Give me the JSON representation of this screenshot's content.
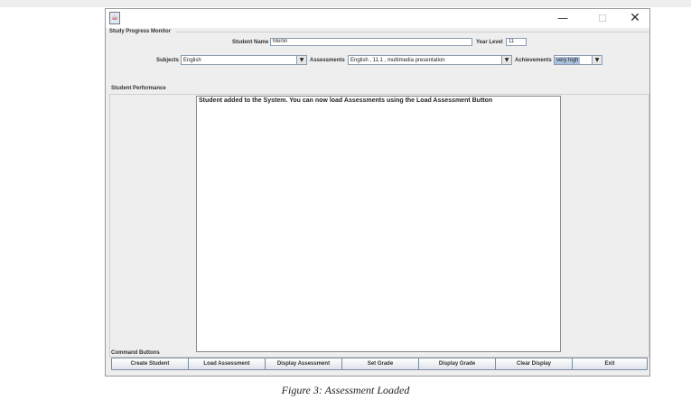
{
  "window": {
    "app_icon": "java-icon",
    "controls": {
      "minimize": "—",
      "maximize": "☐",
      "close": "✕"
    }
  },
  "monitor": {
    "group_title": "Study Progress Monitor",
    "student_name_label": "Student Name",
    "student_name_value": "Merlin",
    "year_level_label": "Year Level",
    "year_level_value": "11",
    "subjects_label": "Subjects",
    "subjects_value": "English",
    "assessments_label": "Assessments",
    "assessments_value": "English , 11.1 , multimedia presentation",
    "achievements_label": "Achievements",
    "achievements_value": "very high"
  },
  "performance": {
    "group_title": "Student Performance",
    "text": "Student added to the System. You can now load Assessments using the Load Assessment Button"
  },
  "commands": {
    "group_title": "Command Buttons",
    "buttons": [
      "Create Student",
      "Load Assessment",
      "Display Assessment",
      "Set Grade",
      "Display Grade",
      "Clear Display",
      "Exit"
    ]
  },
  "caption": "Figure 3: Assessment Loaded"
}
